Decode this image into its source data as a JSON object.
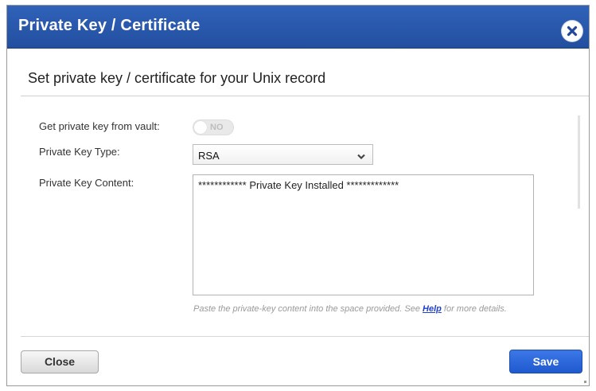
{
  "dialog": {
    "title": "Private Key / Certificate",
    "subtitle": "Set private key / certificate for your Unix record",
    "close_icon": "close-icon"
  },
  "form": {
    "vault": {
      "label": "Get private key from vault:",
      "toggle_text": "NO",
      "enabled": false
    },
    "key_type": {
      "label": "Private Key Type:",
      "selected": "RSA",
      "icon": "chevron-down-icon"
    },
    "key_content": {
      "label": "Private Key Content:",
      "value": "************ Private Key Installed *************"
    },
    "hint": {
      "prefix": "Paste the private-key content into the space provided. See ",
      "link": "Help",
      "suffix": " for more details."
    }
  },
  "footer": {
    "close_label": "Close",
    "save_label": "Save"
  },
  "colors": {
    "titlebar": "#2a5bb0",
    "primary_button": "#2f6ad8",
    "link": "#1f3fd0"
  }
}
